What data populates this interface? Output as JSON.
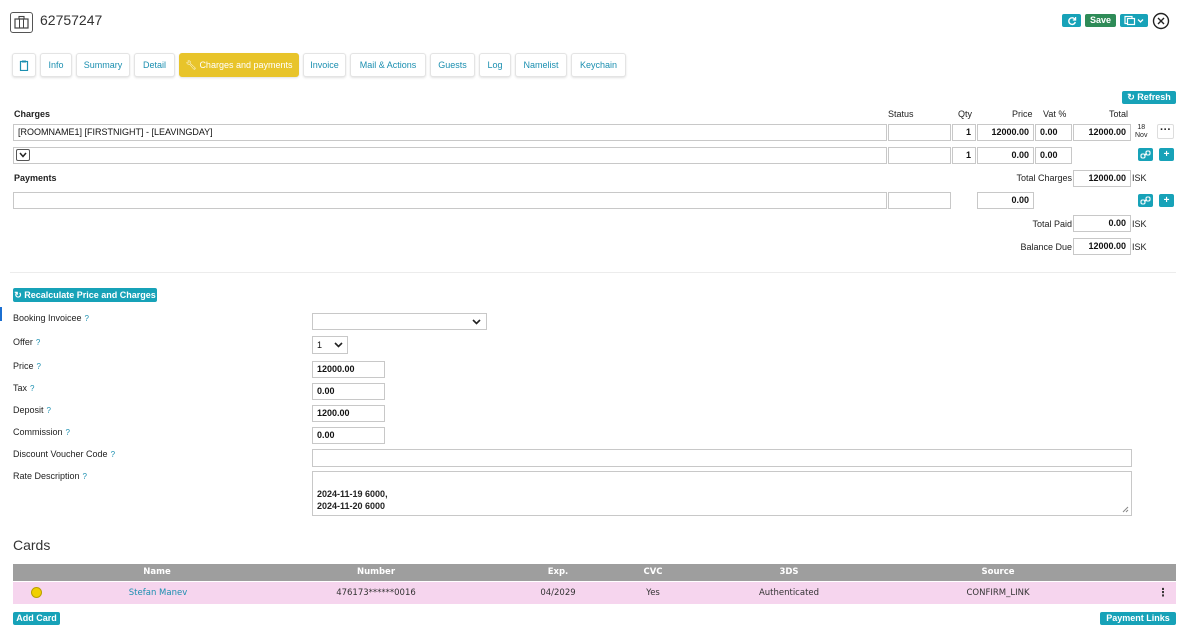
{
  "header": {
    "booking_number": "62757247",
    "save_label": "Save",
    "close_glyph": "×"
  },
  "tabs": [
    {
      "label": ""
    },
    {
      "label": "Info"
    },
    {
      "label": "Summary"
    },
    {
      "label": "Detail"
    },
    {
      "label": "Charges and payments",
      "active": true
    },
    {
      "label": "Invoice"
    },
    {
      "label": "Mail & Actions"
    },
    {
      "label": "Guests"
    },
    {
      "label": "Log"
    },
    {
      "label": "Namelist"
    },
    {
      "label": "Keychain"
    }
  ],
  "refresh_label": "Refresh",
  "charges": {
    "heading": "Charges",
    "columns": {
      "status": "Status",
      "qty": "Qty",
      "price": "Price",
      "vat": "Vat %",
      "total": "Total"
    },
    "rows": [
      {
        "description": "[ROOMNAME1] [FIRSTNIGHT] - [LEAVINGDAY]",
        "status": "",
        "qty": "1",
        "price": "12000.00",
        "vat": "0.00",
        "total": "12000.00",
        "date_day": "18",
        "date_month": "Nov",
        "more_glyph": "···"
      }
    ],
    "new_row": {
      "qty": "1",
      "price": "0.00",
      "vat": "0.00"
    }
  },
  "payments": {
    "heading": "Payments",
    "total_charges_label": "Total Charges",
    "total_charges": "12000.00",
    "currency": "ISK",
    "new_row": {
      "amount": "0.00"
    },
    "total_paid_label": "Total Paid",
    "total_paid": "0.00",
    "balance_due_label": "Balance Due",
    "balance_due": "12000.00"
  },
  "recalculate_label": "Recalculate Price and Charges",
  "form": {
    "help_glyph": "?",
    "booking_invoicee_label": "Booking Invoicee",
    "booking_invoicee_value": "",
    "offer_label": "Offer",
    "offer_value": "1",
    "price_label": "Price",
    "price_value": "12000.00",
    "tax_label": "Tax",
    "tax_value": "0.00",
    "deposit_label": "Deposit",
    "deposit_value": "1200.00",
    "commission_label": "Commission",
    "commission_value": "0.00",
    "voucher_label": "Discount Voucher Code",
    "voucher_value": "",
    "rate_label": "Rate Description",
    "rate_line1": "2024-11-19 6000,",
    "rate_line2": "2024-11-20 6000"
  },
  "cards": {
    "heading": "Cards",
    "columns": {
      "name": "Name",
      "number": "Number",
      "exp": "Exp.",
      "cvc": "CVC",
      "threeds": "3DS",
      "source": "Source"
    },
    "rows": [
      {
        "name": "Stefan Manev",
        "number": "476173******0016",
        "exp": "04/2029",
        "cvc": "Yes",
        "threeds": "Authenticated",
        "source": "CONFIRM_LINK",
        "menu_glyph": "⋮",
        "status_color": "#f0d000"
      }
    ],
    "add_card_label": "Add Card",
    "payment_links_label": "Payment Links"
  },
  "colors": {
    "accent": "#17a2b8",
    "save": "#2e8b57",
    "active_tab": "#e8c42a",
    "card_row": "#f6d5ee"
  }
}
